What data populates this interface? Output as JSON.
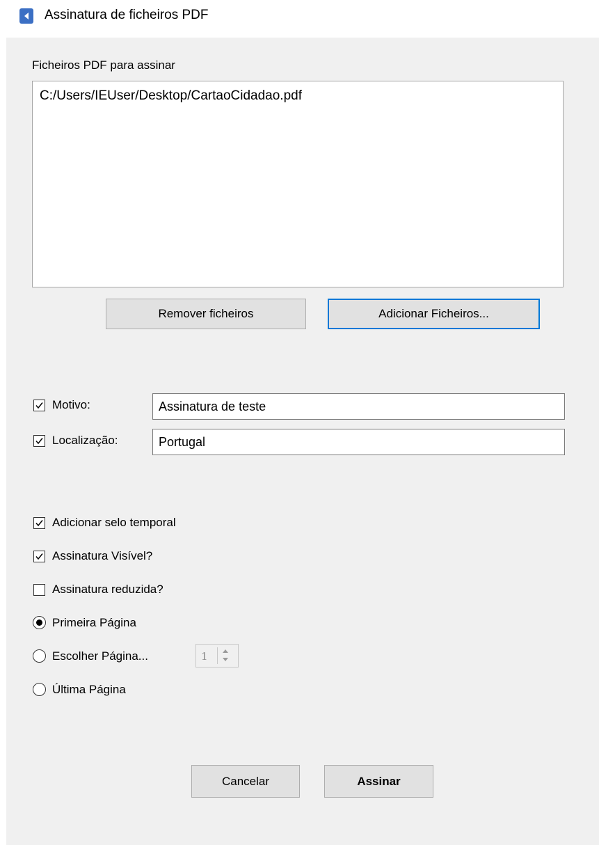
{
  "window": {
    "title": "Assinatura de ficheiros PDF"
  },
  "files_section": {
    "label": "Ficheiros PDF para assinar",
    "files": [
      "C:/Users/IEUser/Desktop/CartaoCidadao.pdf"
    ],
    "remove_button": "Remover ficheiros",
    "add_button": "Adicionar Ficheiros..."
  },
  "fields": {
    "motivo": {
      "label": "Motivo:",
      "checked": true,
      "value": "Assinatura de teste"
    },
    "localizacao": {
      "label": "Localização:",
      "checked": true,
      "value": "Portugal"
    }
  },
  "options": {
    "timestamp": {
      "label": "Adicionar selo temporal",
      "checked": true
    },
    "visible": {
      "label": "Assinatura Visível?",
      "checked": true
    },
    "reduced": {
      "label": "Assinatura reduzida?",
      "checked": false
    }
  },
  "page_choice": {
    "first": {
      "label": "Primeira Página",
      "selected": true
    },
    "choose": {
      "label": "Escolher Página...",
      "selected": false,
      "page_number": "1"
    },
    "last": {
      "label": "Última Página",
      "selected": false
    }
  },
  "footer": {
    "cancel_button": "Cancelar",
    "sign_button": "Assinar"
  },
  "colors": {
    "accent": "#0078d7",
    "background": "#f0f0f0",
    "app_icon": "#3b6fc4"
  }
}
